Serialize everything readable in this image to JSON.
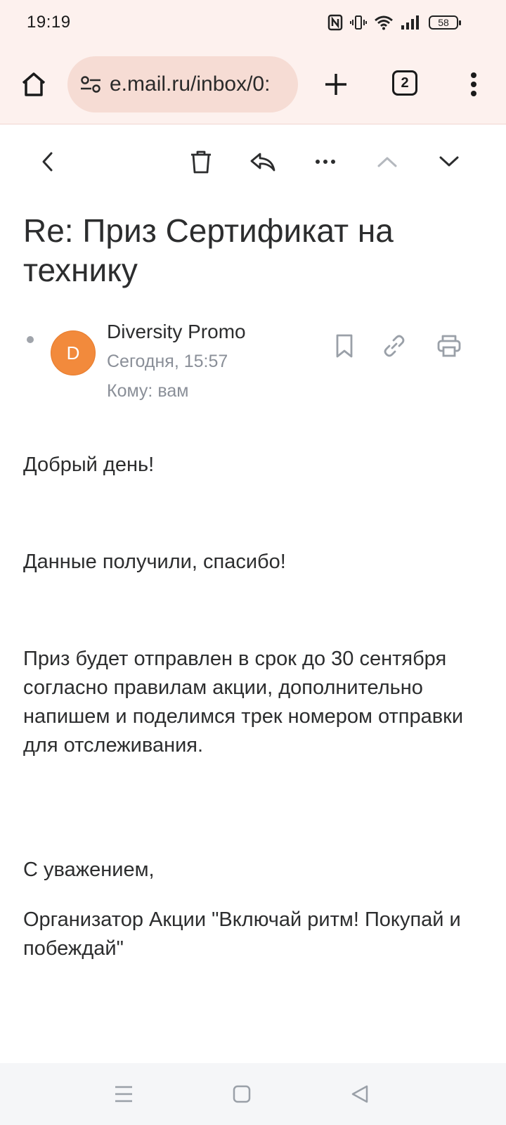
{
  "status_bar": {
    "time": "19:19",
    "battery": "58",
    "icons": [
      "nfc-icon",
      "vibrate-icon",
      "wifi-icon",
      "signal-icon",
      "battery-icon"
    ]
  },
  "browser": {
    "url": "e.mail.ru/inbox/0:",
    "tab_count": "2",
    "accent_bg": "#fdf1ee",
    "urlbar_bg": "#f6dcd4"
  },
  "toolbar": {
    "icons": [
      "back-chevron-icon",
      "trash-icon",
      "reply-all-icon",
      "more-horizontal-icon",
      "chevron-up-icon",
      "chevron-down-icon"
    ]
  },
  "email": {
    "subject": "Re: Приз Сертификат на технику",
    "sender": {
      "avatar_letter": "D",
      "avatar_color": "#f28a3c",
      "name": "Diversity Promo",
      "date": "Сегодня, 15:57",
      "to": "Кому: вам"
    },
    "body": [
      "Добрый день!",
      "Данные получили, спасибо!",
      "Приз будет отправлен в срок до 30 сентября согласно правилам акции, дополнительно напишем и поделимся трек номером отправки для отслеживания.",
      "С уважением,",
      "Организатор Акции \"Включай ритм! Покупай и побеждай\""
    ]
  },
  "navbar": {
    "icons": [
      "recents-icon",
      "home-square-icon",
      "back-triangle-icon"
    ]
  }
}
